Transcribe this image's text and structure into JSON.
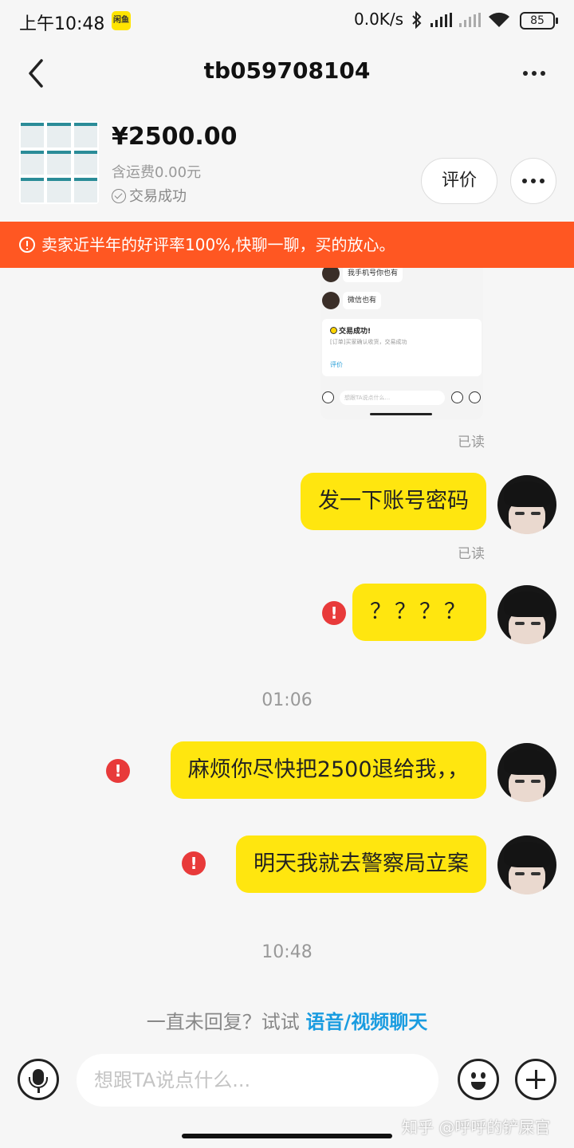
{
  "status_bar": {
    "time": "上午10:48",
    "app_badge": "闲鱼",
    "network_speed": "0.0K/s",
    "battery": "85"
  },
  "header": {
    "title": "tb059708104"
  },
  "item": {
    "price": "¥2500.00",
    "shipping": "含运费0.00元",
    "status": "交易成功",
    "review_button": "评价"
  },
  "banner": {
    "text": "卖家近半年的好评率100%,快聊一聊，买的放心。"
  },
  "embedded_screenshot": {
    "messages": [
      "我手机号你也有",
      "微信也有"
    ],
    "card_title": "交易成功!",
    "card_sub": "[订单]买家确认收货，交易成功",
    "card_link": "评价",
    "input_placeholder": "想跟TA说点什么..."
  },
  "messages": [
    {
      "read_status": "已读",
      "text": "发一下账号密码"
    },
    {
      "read_status": "已读",
      "text": "？？？？"
    },
    {
      "text": "麻烦你尽快把2500退给我，，"
    },
    {
      "text": "明天我就去警察局立案"
    }
  ],
  "timestamps": [
    "01:06",
    "10:48"
  ],
  "error_mark": "!",
  "hint": {
    "prefix": "一直未回复？试试 ",
    "link": "语音/视频聊天"
  },
  "input": {
    "placeholder": "想跟TA说点什么..."
  },
  "watermark": "知乎 @呼呼的铲屎官",
  "colors": {
    "bubble": "#ffe60f",
    "banner": "#ff5722",
    "link": "#1a9ce0",
    "error": "#e83a3a"
  }
}
